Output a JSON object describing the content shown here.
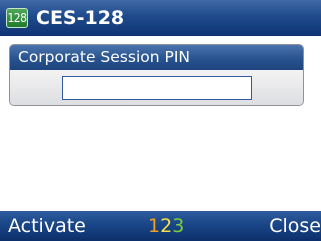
{
  "title_bar": {
    "app_badge": "128",
    "title": "CES-128"
  },
  "pin_field": {
    "label": "Corporate Session PIN",
    "value": "",
    "placeholder": ""
  },
  "softkeys": {
    "left": "Activate",
    "right": "Close",
    "input_mode": {
      "chars": [
        "1",
        "2",
        "3"
      ],
      "colors": [
        "#f0a020",
        "#f1e04a",
        "#78cf3c"
      ]
    }
  }
}
